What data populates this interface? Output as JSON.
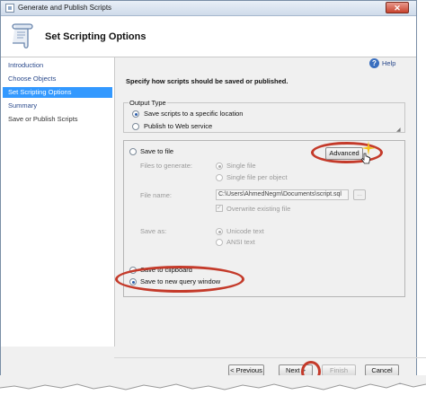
{
  "window": {
    "title": "Generate and Publish Scripts",
    "close_glyph": "✕"
  },
  "header": {
    "title": "Set Scripting Options"
  },
  "sidebar": {
    "items": [
      {
        "label": "Introduction"
      },
      {
        "label": "Choose Objects"
      },
      {
        "label": "Set Scripting Options",
        "active": true
      },
      {
        "label": "Summary"
      },
      {
        "label": "Save or Publish Scripts"
      }
    ]
  },
  "help": {
    "label": "Help",
    "glyph": "?"
  },
  "main": {
    "instruction": "Specify how scripts should be saved or published.",
    "output_type": {
      "legend": "Output Type",
      "options": [
        {
          "label": "Save scripts to a specific location",
          "selected": true
        },
        {
          "label": "Publish to Web service",
          "selected": false
        }
      ]
    },
    "save_to_file": {
      "label": "Save to file",
      "advanced_label": "Advanced",
      "files_to_generate_label": "Files to generate:",
      "single_file_label": "Single file",
      "single_file_per_object_label": "Single file per object",
      "file_name_label": "File name:",
      "file_name_value": "C:\\Users\\AhmedNegm\\Documents\\script.sql",
      "browse_label": "...",
      "overwrite_label": "Overwrite existing file",
      "save_as_label": "Save as:",
      "unicode_label": "Unicode text",
      "ansi_label": "ANSI text"
    },
    "save_to_clipboard": {
      "label": "Save to clipboard"
    },
    "save_to_query": {
      "label": "Save to new query window"
    }
  },
  "footer": {
    "previous_label": "< Previous",
    "next_label": "Next >",
    "finish_label": "Finish",
    "cancel_label": "Cancel"
  },
  "colors": {
    "accent": "#3399ff",
    "annotation": "#c43a2a"
  }
}
